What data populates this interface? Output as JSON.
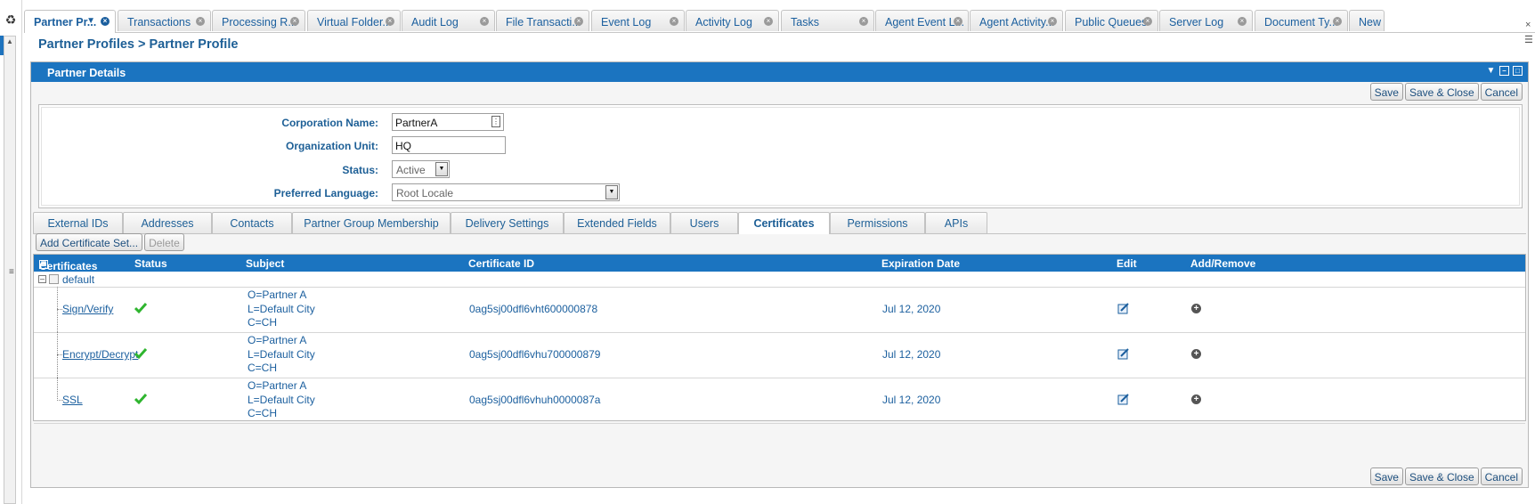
{
  "tabs": [
    {
      "label": "Partner Pr...",
      "active": true
    },
    {
      "label": "Transactions"
    },
    {
      "label": "Processing R..."
    },
    {
      "label": "Virtual Folder..."
    },
    {
      "label": "Audit Log"
    },
    {
      "label": "File Transacti..."
    },
    {
      "label": "Event Log"
    },
    {
      "label": "Activity Log"
    },
    {
      "label": "Tasks"
    },
    {
      "label": "Agent Event L..."
    },
    {
      "label": "Agent Activity..."
    },
    {
      "label": "Public Queues"
    },
    {
      "label": "Server Log"
    },
    {
      "label": "Document Ty..."
    },
    {
      "label": "New"
    }
  ],
  "breadcrumb": "Partner Profiles > Partner Profile",
  "panel": {
    "title": "Partner Details",
    "buttons": {
      "save": "Save",
      "save_close": "Save & Close",
      "cancel": "Cancel"
    }
  },
  "form": {
    "corporation_name": {
      "label": "Corporation Name:",
      "value": "PartnerA"
    },
    "organization_unit": {
      "label": "Organization Unit:",
      "value": "HQ"
    },
    "status": {
      "label": "Status:",
      "value": "Active"
    },
    "preferred_language": {
      "label": "Preferred Language:",
      "value": "Root Locale"
    }
  },
  "subtabs": [
    {
      "label": "External IDs"
    },
    {
      "label": "Addresses"
    },
    {
      "label": "Contacts"
    },
    {
      "label": "Partner Group Membership"
    },
    {
      "label": "Delivery Settings"
    },
    {
      "label": "Extended Fields"
    },
    {
      "label": "Users"
    },
    {
      "label": "Certificates",
      "active": true
    },
    {
      "label": "Permissions"
    },
    {
      "label": "APIs"
    }
  ],
  "toolbar": {
    "add_certificate_set": "Add Certificate Set...",
    "delete": "Delete"
  },
  "grid": {
    "columns": {
      "certificates": "Certificates",
      "status": "Status",
      "subject": "Subject",
      "certificate_id": "Certificate ID",
      "expiration_date": "Expiration Date",
      "edit": "Edit",
      "add_remove": "Add/Remove"
    },
    "group": "default",
    "rows": [
      {
        "name": "Sign/Verify",
        "subject_o": "O=Partner A",
        "subject_l": "L=Default City",
        "subject_c": "C=CH",
        "certificate_id": "0ag5sj00dfl6vht600000878",
        "expiration": "Jul 12, 2020"
      },
      {
        "name": "Encrypt/Decrypt",
        "subject_o": "O=Partner A",
        "subject_l": "L=Default City",
        "subject_c": "C=CH",
        "certificate_id": "0ag5sj00dfl6vhu700000879",
        "expiration": "Jul 12, 2020"
      },
      {
        "name": "SSL",
        "subject_o": "O=Partner A",
        "subject_l": "L=Default City",
        "subject_c": "C=CH",
        "certificate_id": "0ag5sj00dfl6vhuh0000087a",
        "expiration": "Jul 12, 2020"
      }
    ]
  },
  "colors": {
    "header_blue": "#1b74c0",
    "link_blue": "#1b5f9e",
    "check_green": "#2fb52f"
  }
}
